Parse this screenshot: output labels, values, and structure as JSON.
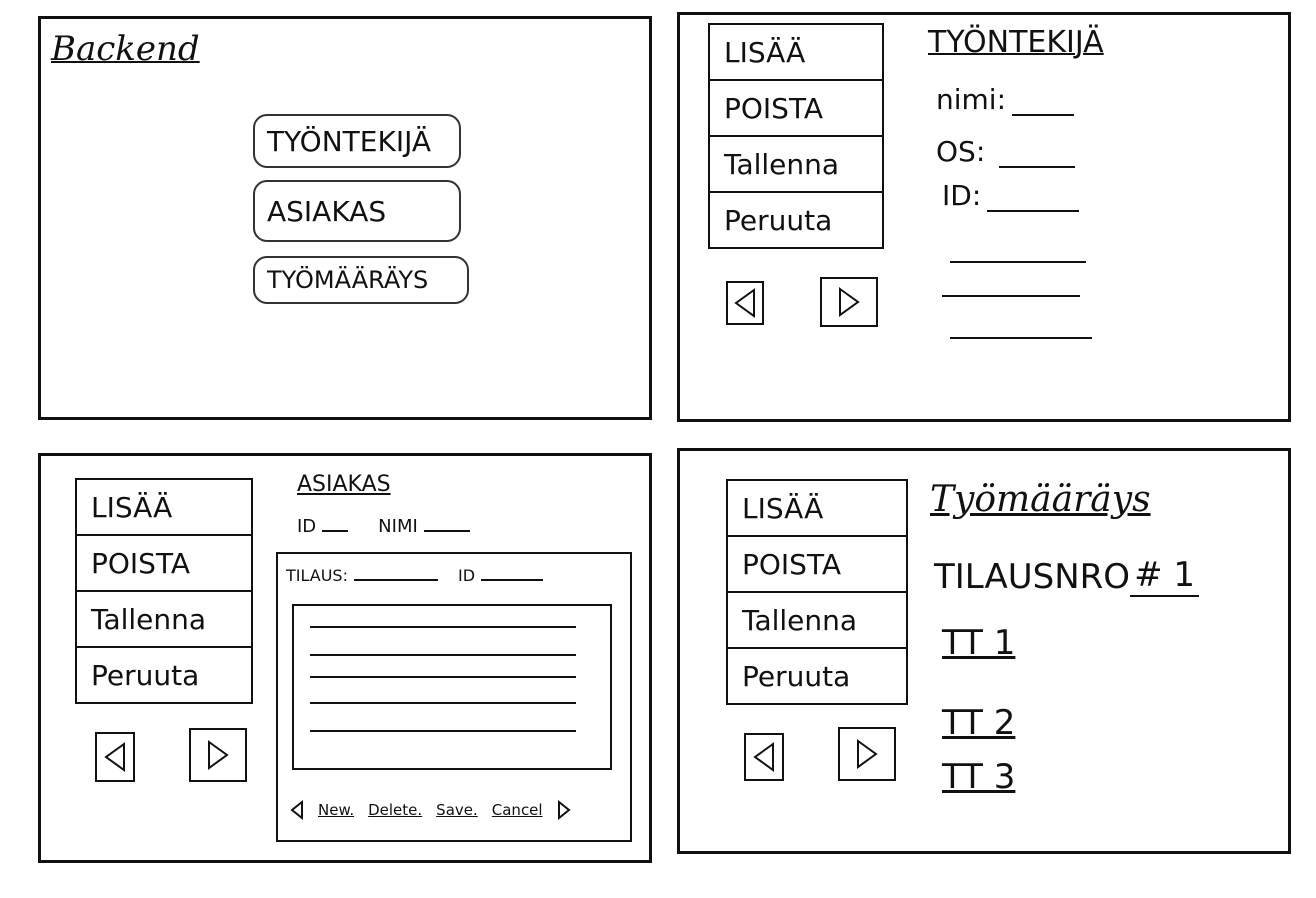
{
  "backend_panel": {
    "title": "Backend",
    "nav": {
      "employee_label": "TYÖNTEKIJÄ",
      "customer_label": "ASIAKAS",
      "work_order_label": "TYÖMÄÄRÄYS"
    }
  },
  "action_menu": {
    "add_label": "LISÄÄ",
    "delete_label": "POISTA",
    "save_label": "Tallenna",
    "cancel_label": "Peruuta"
  },
  "arrows": {
    "prev_icon": "triangle-left-icon",
    "next_icon": "triangle-right-icon"
  },
  "employee_panel": {
    "heading": "TYÖNTEKIJÄ",
    "name_label": "nimi:",
    "os_label": "OS:",
    "id_label": "ID:"
  },
  "customer_panel": {
    "heading": "ASIAKAS",
    "id_label": "ID",
    "name_label": "NIMI",
    "orders": {
      "tilaus_label": "TILAUS:",
      "id_label": "ID",
      "toolbar": {
        "new_label": "New.",
        "delete_label": "Delete.",
        "save_label": "Save.",
        "cancel_label": "Cancel"
      }
    }
  },
  "work_order_panel": {
    "title": "Työmääräys",
    "order_number_label": "TILAUSNRO",
    "order_number_value": "# 1",
    "items": [
      "TT 1",
      "TT 2",
      "TT 3"
    ]
  }
}
